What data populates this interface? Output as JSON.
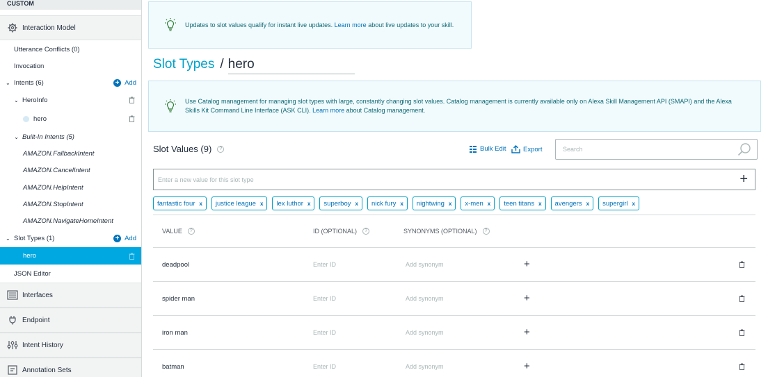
{
  "sidebar": {
    "custom_label": "CUSTOM",
    "interaction_model": "Interaction Model",
    "utterance_conflicts": "Utterance Conflicts (0)",
    "invocation": "Invocation",
    "intents": "Intents (6)",
    "add_label": "Add",
    "hero_info": "HeroInfo",
    "hero_slot": "hero",
    "builtin_intents": "Built-In Intents (5)",
    "builtin": [
      "AMAZON.FallbackIntent",
      "AMAZON.CancelIntent",
      "AMAZON.HelpIntent",
      "AMAZON.StopIntent",
      "AMAZON.NavigateHomeIntent"
    ],
    "slot_types": "Slot Types (1)",
    "active_slot": "hero",
    "json_editor": "JSON Editor",
    "interfaces": "Interfaces",
    "endpoint": "Endpoint",
    "intent_history": "Intent History",
    "annotation_sets": "Annotation Sets"
  },
  "info1": {
    "text": "Updates to slot values qualify for instant live updates.",
    "link": "Learn more",
    "tail": "about live updates to your skill."
  },
  "breadcrumb": {
    "link": "Slot Types",
    "sep": "/",
    "current": "hero"
  },
  "info2": {
    "text": "Use Catalog management for managing slot types with large, constantly changing slot values. Catalog management is currently available only on Alexa Skill Management API (SMAPI) and the Alexa Skills Kit Command Line Interface (ASK CLI).",
    "link": "Learn more",
    "tail": "about Catalog management."
  },
  "slot_values": {
    "title": "Slot Values (9)",
    "help": "?",
    "bulk_edit": "Bulk Edit",
    "export": "Export",
    "search_placeholder": "Search",
    "new_value_placeholder": "Enter a new value for this slot type",
    "plus": "+",
    "chips": [
      "fantastic four",
      "justice league",
      "lex luthor",
      "superboy",
      "nick fury",
      "nightwing",
      "x-men",
      "teen titans",
      "avengers",
      "supergirl"
    ],
    "chip_remove": "x"
  },
  "table": {
    "headers": {
      "value": "VALUE",
      "id": "ID (OPTIONAL)",
      "synonyms": "SYNONYMS (OPTIONAL)"
    },
    "id_placeholder": "Enter ID",
    "syn_placeholder": "Add synonym",
    "rows": [
      {
        "value": "deadpool"
      },
      {
        "value": "spider man"
      },
      {
        "value": "iron man"
      },
      {
        "value": "batman"
      }
    ]
  },
  "colors": {
    "accent": "#00a8e1",
    "link": "#0073bb",
    "chip_border": "#00a1c9"
  }
}
